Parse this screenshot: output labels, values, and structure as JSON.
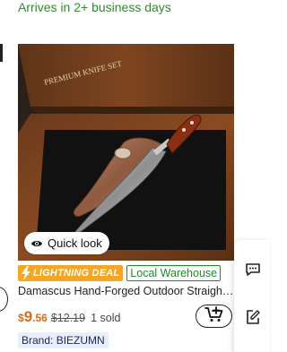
{
  "delivery": {
    "text": "Arrives in 2+ business days"
  },
  "product": {
    "image_label": "PREMIUM KNIFE SET",
    "quick_look_label": "Quick look",
    "badge_lightning": "LIGHTNING DEAL",
    "badge_local": "Local Warehouse",
    "title": "Damascus Hand-Forged Outdoor Straight Knife",
    "price_currency": "$",
    "price_integer": "9",
    "price_decimal": ".56",
    "old_price": "$12.19",
    "sold": "1 sold",
    "brand": "Brand: BIEZUMN"
  },
  "colors": {
    "price": "#e06a12",
    "delivery_green": "#2e8b2e",
    "lightning_orange": "#f5a623",
    "local_green": "#1f8a2b",
    "brand_bg": "#e8eefb"
  },
  "icons": {
    "quick_look": "eye-icon",
    "lightning": "lightning-bolt-icon",
    "cart": "add-to-cart-icon",
    "chat": "chat-icon",
    "edit": "edit-icon"
  }
}
